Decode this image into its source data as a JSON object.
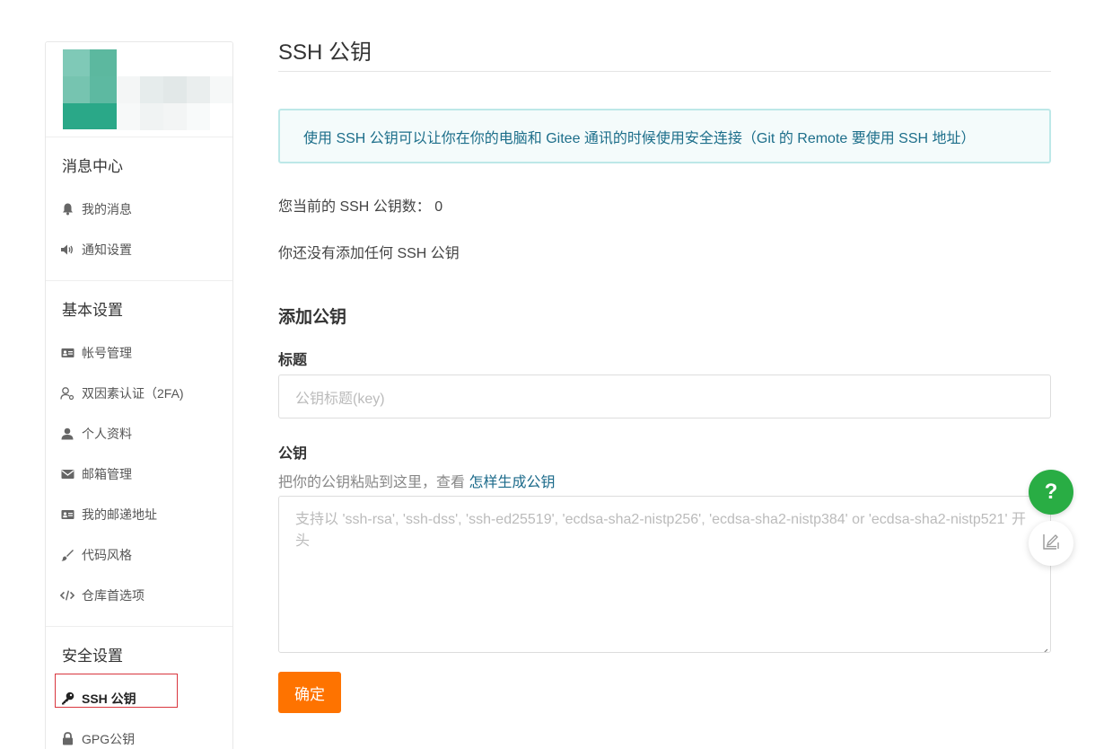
{
  "sidebar": {
    "sections": [
      {
        "title": "消息中心",
        "items": [
          {
            "label": "我的消息",
            "icon": "bell-icon"
          },
          {
            "label": "通知设置",
            "icon": "speaker-icon"
          }
        ]
      },
      {
        "title": "基本设置",
        "items": [
          {
            "label": "帐号管理",
            "icon": "id-card-icon"
          },
          {
            "label": "双因素认证（2FA)",
            "icon": "user-outline-icon"
          },
          {
            "label": "个人资料",
            "icon": "user-icon"
          },
          {
            "label": "邮箱管理",
            "icon": "envelope-icon"
          },
          {
            "label": "我的邮递地址",
            "icon": "address-card-icon"
          },
          {
            "label": "代码风格",
            "icon": "brush-icon"
          },
          {
            "label": "仓库首选项",
            "icon": "code-icon"
          }
        ]
      },
      {
        "title": "安全设置",
        "items": [
          {
            "label": "SSH 公钥",
            "icon": "key-icon",
            "active": true
          },
          {
            "label": "GPG公钥",
            "icon": "lock-icon"
          }
        ]
      }
    ]
  },
  "main": {
    "title": "SSH 公钥",
    "info": "使用 SSH 公钥可以让你在你的电脑和 Gitee 通讯的时候使用安全连接（Git 的 Remote 要使用 SSH 地址）",
    "count_label": "您当前的 SSH 公钥数：",
    "count_value": "0",
    "none_text": "你还没有添加任何 SSH 公钥",
    "add_title": "添加公钥",
    "title_label": "标题",
    "title_placeholder": "公钥标题(key)",
    "key_label": "公钥",
    "key_hint": "把你的公钥粘贴到这里，查看 ",
    "key_hint_link": "怎样生成公钥",
    "key_placeholder": "支持以 'ssh-rsa', 'ssh-dss', 'ssh-ed25519', 'ecdsa-sha2-nistp256', 'ecdsa-sha2-nistp384' or 'ecdsa-sha2-nistp521' 开头",
    "submit_label": "确定"
  },
  "floating": {
    "help_label": "?",
    "help_color": "#29ad44"
  },
  "colors": {
    "accent_orange": "#fe7300",
    "info_text": "#1c6e8a",
    "active_border": "#d9363e"
  }
}
